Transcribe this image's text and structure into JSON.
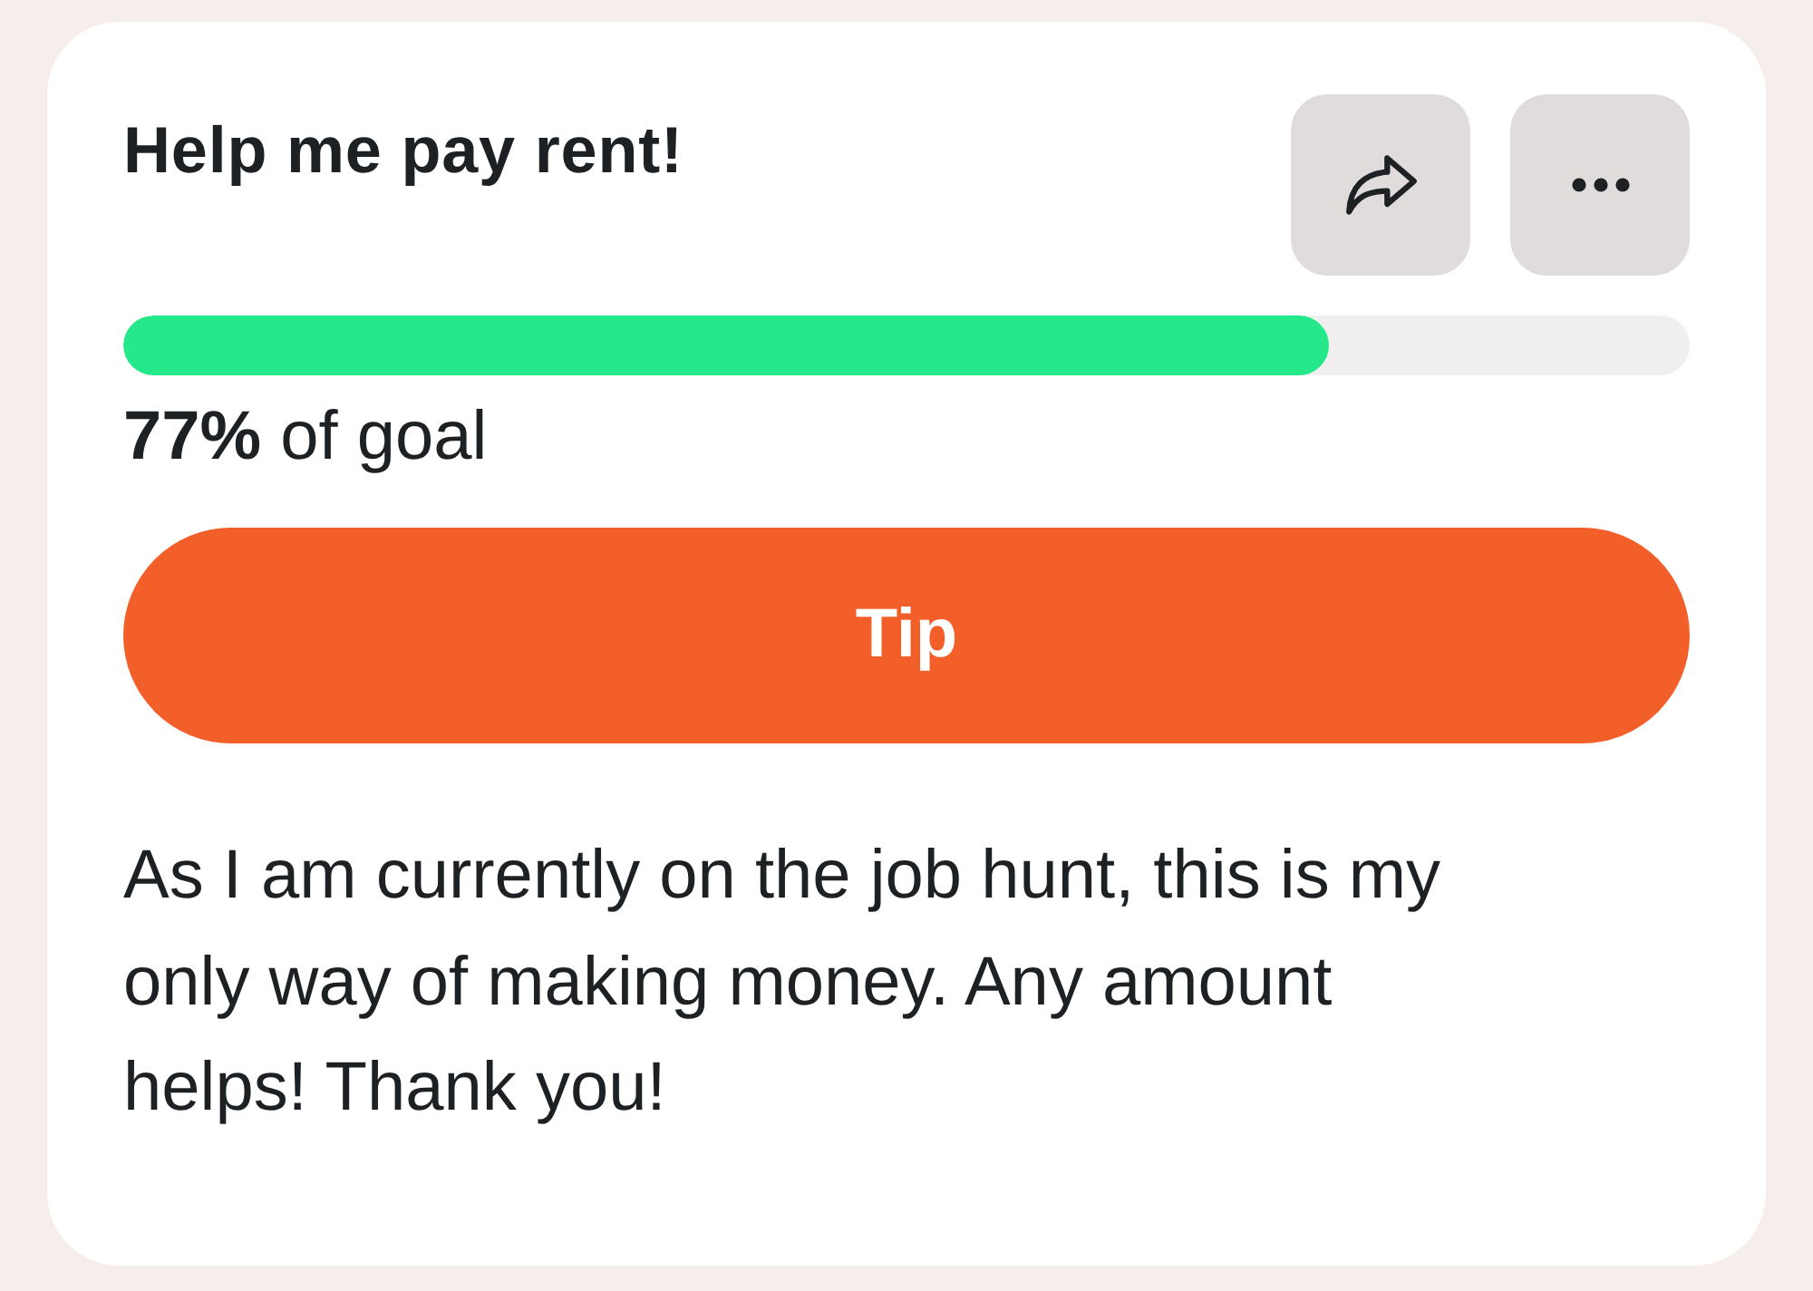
{
  "card": {
    "title": "Help me pay rent!",
    "actions": [
      {
        "kind": "share"
      },
      {
        "kind": "more"
      }
    ],
    "progress": {
      "level": 0.77,
      "label": "**77%** of goal"
    },
    "tip_button": {
      "label": "Tip"
    },
    "description": "As I am currently on the job hunt, this is my only way of making money. Any amount helps! Thank you!"
  }
}
